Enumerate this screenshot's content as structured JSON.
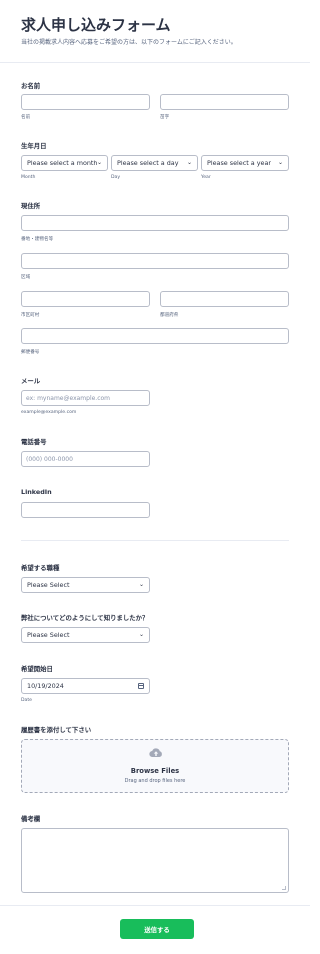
{
  "header": {
    "title": "求人申し込みフォーム",
    "subtitle": "当社の掲載求人内容へ応募をご希望の方は、以下のフォームにご記入ください。"
  },
  "name": {
    "label": "お名前",
    "first_sub": "名前",
    "last_sub": "苗字"
  },
  "birthdate": {
    "label": "生年月日",
    "month": "Please select a month",
    "day": "Please select a day",
    "year": "Please select a year",
    "month_sub": "Month",
    "day_sub": "Day",
    "year_sub": "Year"
  },
  "address": {
    "label": "現住所",
    "street_sub": "番地・建物名等",
    "area_sub": "区域",
    "city_sub": "市区町村",
    "prefecture_sub": "都道府県",
    "postal_sub": "郵便番号"
  },
  "email": {
    "label": "メール",
    "placeholder": "ex: myname@example.com",
    "sub": "example@example.com"
  },
  "phone": {
    "label": "電話番号",
    "placeholder": "(000) 000-0000"
  },
  "linkedin": {
    "label": "LinkedIn"
  },
  "position": {
    "label": "希望する職種",
    "value": "Please Select"
  },
  "source": {
    "label": "弊社についてどのようにして知りましたか？",
    "value": "Please Select"
  },
  "start_date": {
    "label": "希望開始日",
    "value": "10/19/2024",
    "sub": "Date"
  },
  "resume": {
    "label": "履歴書を添付して下さい",
    "title": "Browse Files",
    "subtitle": "Drag and drop files here"
  },
  "notes": {
    "label": "備考欄"
  },
  "submit": {
    "label": "送信する"
  },
  "colors": {
    "submit": "#18bd5b",
    "text": "#2c3345"
  }
}
